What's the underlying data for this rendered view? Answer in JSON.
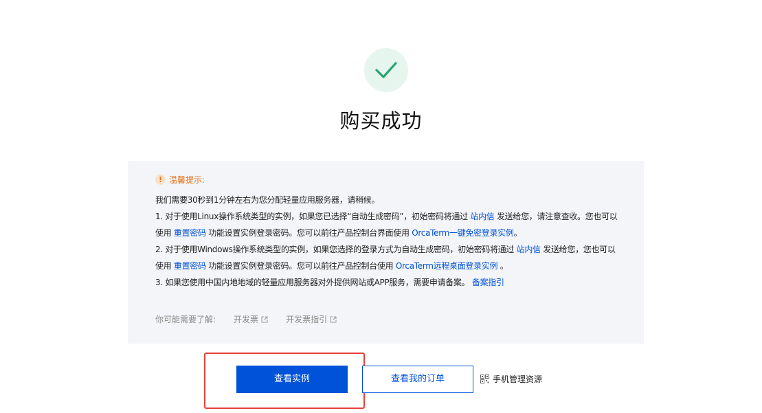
{
  "result": {
    "title": "购买成功",
    "accent_color": "#2ba471",
    "badge_bg": "#e6f5ee",
    "icon": "check-icon"
  },
  "notice": {
    "header_icon": "warning-icon",
    "header": "温馨提示:",
    "intro": "我们需要30秒到1分钟左右为您分配轻量应用服务器，请稍候。",
    "item1": {
      "text_a": "1. 对于使用Linux操作系统类型的实例，如果您已选择“自动生成密码”，初始密码将通过 ",
      "link_a": "站内信",
      "text_b": " 发送给您，请注意查收。您也可以使用 ",
      "link_b": "重置密码",
      "text_c": " 功能设置实例登录密码。您可以前往产品控制台界面使用 ",
      "link_c": "OrcaTerm一键免密登录实例",
      "text_d": "。"
    },
    "item2": {
      "text_a": "2. 对于使用Windows操作系统类型的实例，如果您选择的登录方式为自动生成密码，初始密码将通过 ",
      "link_a": "站内信",
      "text_b": " 发送给您，您也可以使用 ",
      "link_b": "重置密码",
      "text_c": " 功能设置实例登录密码。您可以前往产品控制台使用 ",
      "link_c": "OrcaTerm远程桌面登录实例",
      "text_d": " 。"
    },
    "item3": {
      "text_a": "3. 如果您使用中国内地地域的轻量应用服务器对外提供网站或APP服务，需要申请备案。 ",
      "link_a": "备案指引"
    },
    "footer": {
      "label": "你可能需要了解:",
      "links": [
        {
          "label": "开发票",
          "icon": "external-link-icon"
        },
        {
          "label": "开发票指引",
          "icon": "external-link-icon"
        }
      ]
    }
  },
  "actions": {
    "primary": "查看实例",
    "secondary": "查看我的订单",
    "mobile": {
      "label": "手机管理资源",
      "icon": "qr-code-icon"
    }
  },
  "colors": {
    "primary": "#0052d9",
    "highlight_border": "#e8403a",
    "notice_bg": "#f3f5f8",
    "warning": "#e37318"
  }
}
